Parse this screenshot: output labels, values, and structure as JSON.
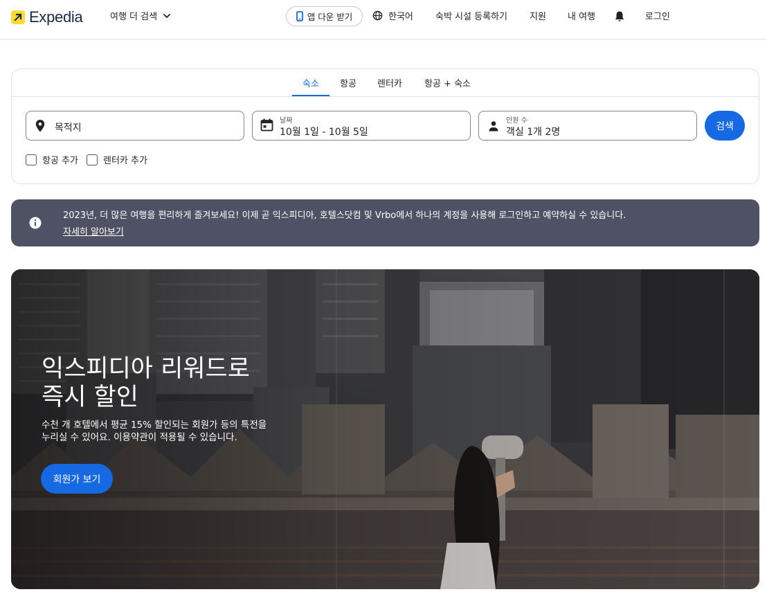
{
  "header": {
    "logo_text": "Expedia",
    "more_travel": "여행 더 검색",
    "app_download": "앱 다운 받기",
    "language": "한국어",
    "list_property": "숙박 시설 등록하기",
    "support": "지원",
    "trips": "내 여행",
    "sign_in": "로그인"
  },
  "search": {
    "tabs": [
      "숙소",
      "항공",
      "렌터카",
      "항공 + 숙소"
    ],
    "active_tab": "숙소",
    "destination_placeholder": "목적지",
    "dates_label": "날짜",
    "dates_value": "10월 1일 - 10월 5일",
    "travelers_label": "인원 수",
    "travelers_value": "객실 1개 2명",
    "search_button": "검색",
    "add_flight": "항공 추가",
    "add_car": "렌터카 추가"
  },
  "info_banner": {
    "text": "2023년, 더 많은 여행을 편리하게 즐겨보세요! 이제 곧 익스피디아, 호텔스닷컴 및 Vrbo에서 하나의 계정을 사용해 로그인하고 예약하실 수 있습니다.",
    "link": "자세히 알아보기"
  },
  "hero": {
    "title": "익스피디아 리워드로 즉시 할인",
    "subtitle": "수천 개 호텔에서 평균 15% 할인되는 회원가 등의 특전을 누리실 수 있어요. 이용약관이 적용될 수 있습니다.",
    "button": "회원가 보기"
  },
  "colors": {
    "accent": "#1668e3",
    "logo_yellow": "#fddb32",
    "banner_bg": "#4f5265"
  }
}
